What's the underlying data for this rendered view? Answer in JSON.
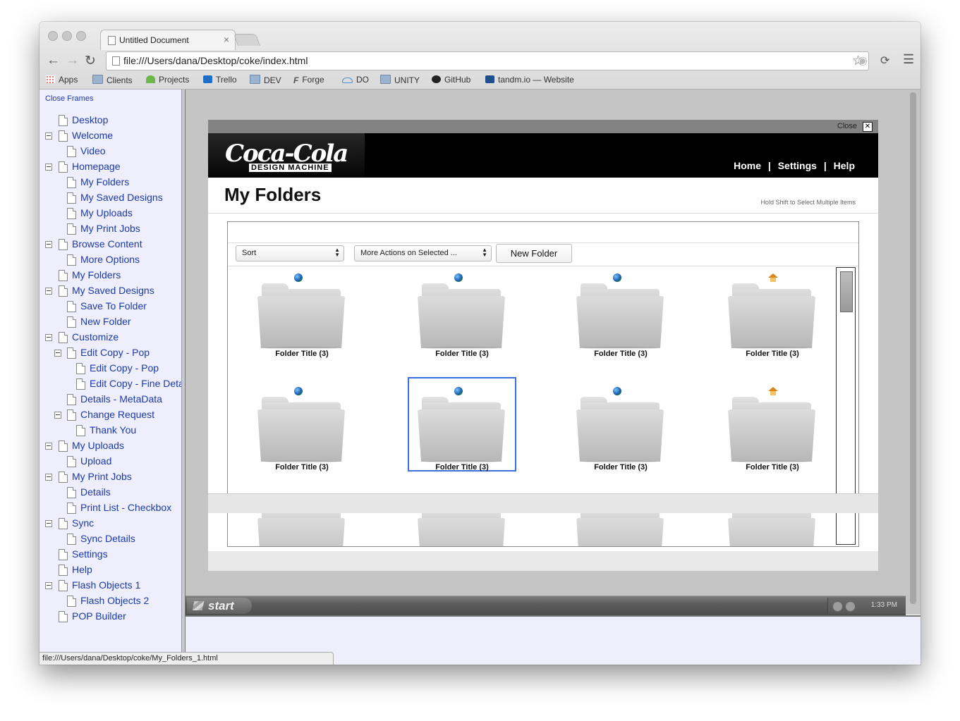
{
  "browser": {
    "tab_title": "Untitled Document",
    "tab_close": "×",
    "url": "file:///Users/dana/Desktop/coke/index.html",
    "bookmarks": [
      "Apps",
      "Clients",
      "Projects",
      "Trello",
      "DEV",
      "Forge",
      "DO",
      "UNITY",
      "GitHub",
      "tandm.io — Website"
    ],
    "status_url": "file:///Users/dana/Desktop/coke/My_Folders_1.html"
  },
  "sidebar": {
    "close_frames": "Close Frames",
    "items": [
      {
        "label": "Desktop",
        "level": 0,
        "toggle": false
      },
      {
        "label": "Welcome",
        "level": 0,
        "toggle": true
      },
      {
        "label": "Video",
        "level": 1,
        "toggle": false
      },
      {
        "label": "Homepage",
        "level": 0,
        "toggle": true
      },
      {
        "label": "My Folders",
        "level": 1,
        "toggle": false
      },
      {
        "label": "My Saved Designs",
        "level": 1,
        "toggle": false
      },
      {
        "label": "My Uploads",
        "level": 1,
        "toggle": false
      },
      {
        "label": "My Print Jobs",
        "level": 1,
        "toggle": false
      },
      {
        "label": "Browse Content",
        "level": 0,
        "toggle": true
      },
      {
        "label": "More Options",
        "level": 1,
        "toggle": false
      },
      {
        "label": "My Folders",
        "level": 0,
        "toggle": false
      },
      {
        "label": "My Saved Designs",
        "level": 0,
        "toggle": true
      },
      {
        "label": "Save To Folder",
        "level": 1,
        "toggle": false
      },
      {
        "label": "New Folder",
        "level": 1,
        "toggle": false
      },
      {
        "label": "Customize",
        "level": 0,
        "toggle": true
      },
      {
        "label": "Edit Copy - Pop",
        "level": 1,
        "toggle": true
      },
      {
        "label": "Edit Copy - Pop",
        "level": 2,
        "toggle": false
      },
      {
        "label": "Edit Copy - Fine Deta",
        "level": 2,
        "toggle": false
      },
      {
        "label": "Details - MetaData",
        "level": 1,
        "toggle": false
      },
      {
        "label": "Change Request",
        "level": 1,
        "toggle": true
      },
      {
        "label": "Thank You",
        "level": 2,
        "toggle": false
      },
      {
        "label": "My Uploads",
        "level": 0,
        "toggle": true
      },
      {
        "label": "Upload",
        "level": 1,
        "toggle": false
      },
      {
        "label": "My Print Jobs",
        "level": 0,
        "toggle": true
      },
      {
        "label": "Details",
        "level": 1,
        "toggle": false
      },
      {
        "label": "Print List - Checkbox",
        "level": 1,
        "toggle": false
      },
      {
        "label": "Sync",
        "level": 0,
        "toggle": true
      },
      {
        "label": "Sync Details",
        "level": 1,
        "toggle": false
      },
      {
        "label": "Settings",
        "level": 0,
        "toggle": false
      },
      {
        "label": "Help",
        "level": 0,
        "toggle": false
      },
      {
        "label": "Flash Objects 1",
        "level": 0,
        "toggle": true
      },
      {
        "label": "Flash Objects 2",
        "level": 1,
        "toggle": false
      },
      {
        "label": "POP Builder",
        "level": 0,
        "toggle": false
      }
    ]
  },
  "modal": {
    "close_label": "Close",
    "close_x": "✕",
    "logo_script": "Coca-Cola",
    "logo_sub": "DESIGN MACHINE",
    "nav": [
      "Home",
      "Settings",
      "Help"
    ],
    "nav_separator": "|",
    "page_title": "My Folders",
    "hint": "Hold Shift to Select Multiple Items",
    "sort_label": "Sort",
    "actions_label": "More Actions on Selected ...",
    "new_folder_label": "New Folder",
    "folders": [
      {
        "title": "Folder Title (3)",
        "badge": "globe-icon",
        "selected": false
      },
      {
        "title": "Folder Title (3)",
        "badge": "globe-icon",
        "selected": false
      },
      {
        "title": "Folder Title (3)",
        "badge": "globe-icon",
        "selected": false
      },
      {
        "title": "Folder Title (3)",
        "badge": "home-icon",
        "selected": false
      },
      {
        "title": "Folder Title (3)",
        "badge": "globe-icon",
        "selected": false
      },
      {
        "title": "Folder Title (3)",
        "badge": "globe-icon",
        "selected": true
      },
      {
        "title": "Folder Title (3)",
        "badge": "globe-icon",
        "selected": false
      },
      {
        "title": "Folder Title (3)",
        "badge": "home-icon",
        "selected": false
      },
      {
        "title": "",
        "badge": "globe-icon",
        "selected": false
      },
      {
        "title": "",
        "badge": "globe-icon",
        "selected": false
      },
      {
        "title": "",
        "badge": "globe-icon",
        "selected": false
      },
      {
        "title": "",
        "badge": "home-icon",
        "selected": false
      }
    ]
  },
  "taskbar": {
    "start_label": "start",
    "clock": "1:33 PM"
  },
  "colors": {
    "sidebar_bg": "#eeeefc",
    "link": "#1a3aa8",
    "brand_bar": "#000000",
    "selection": "#3a6fdc"
  }
}
